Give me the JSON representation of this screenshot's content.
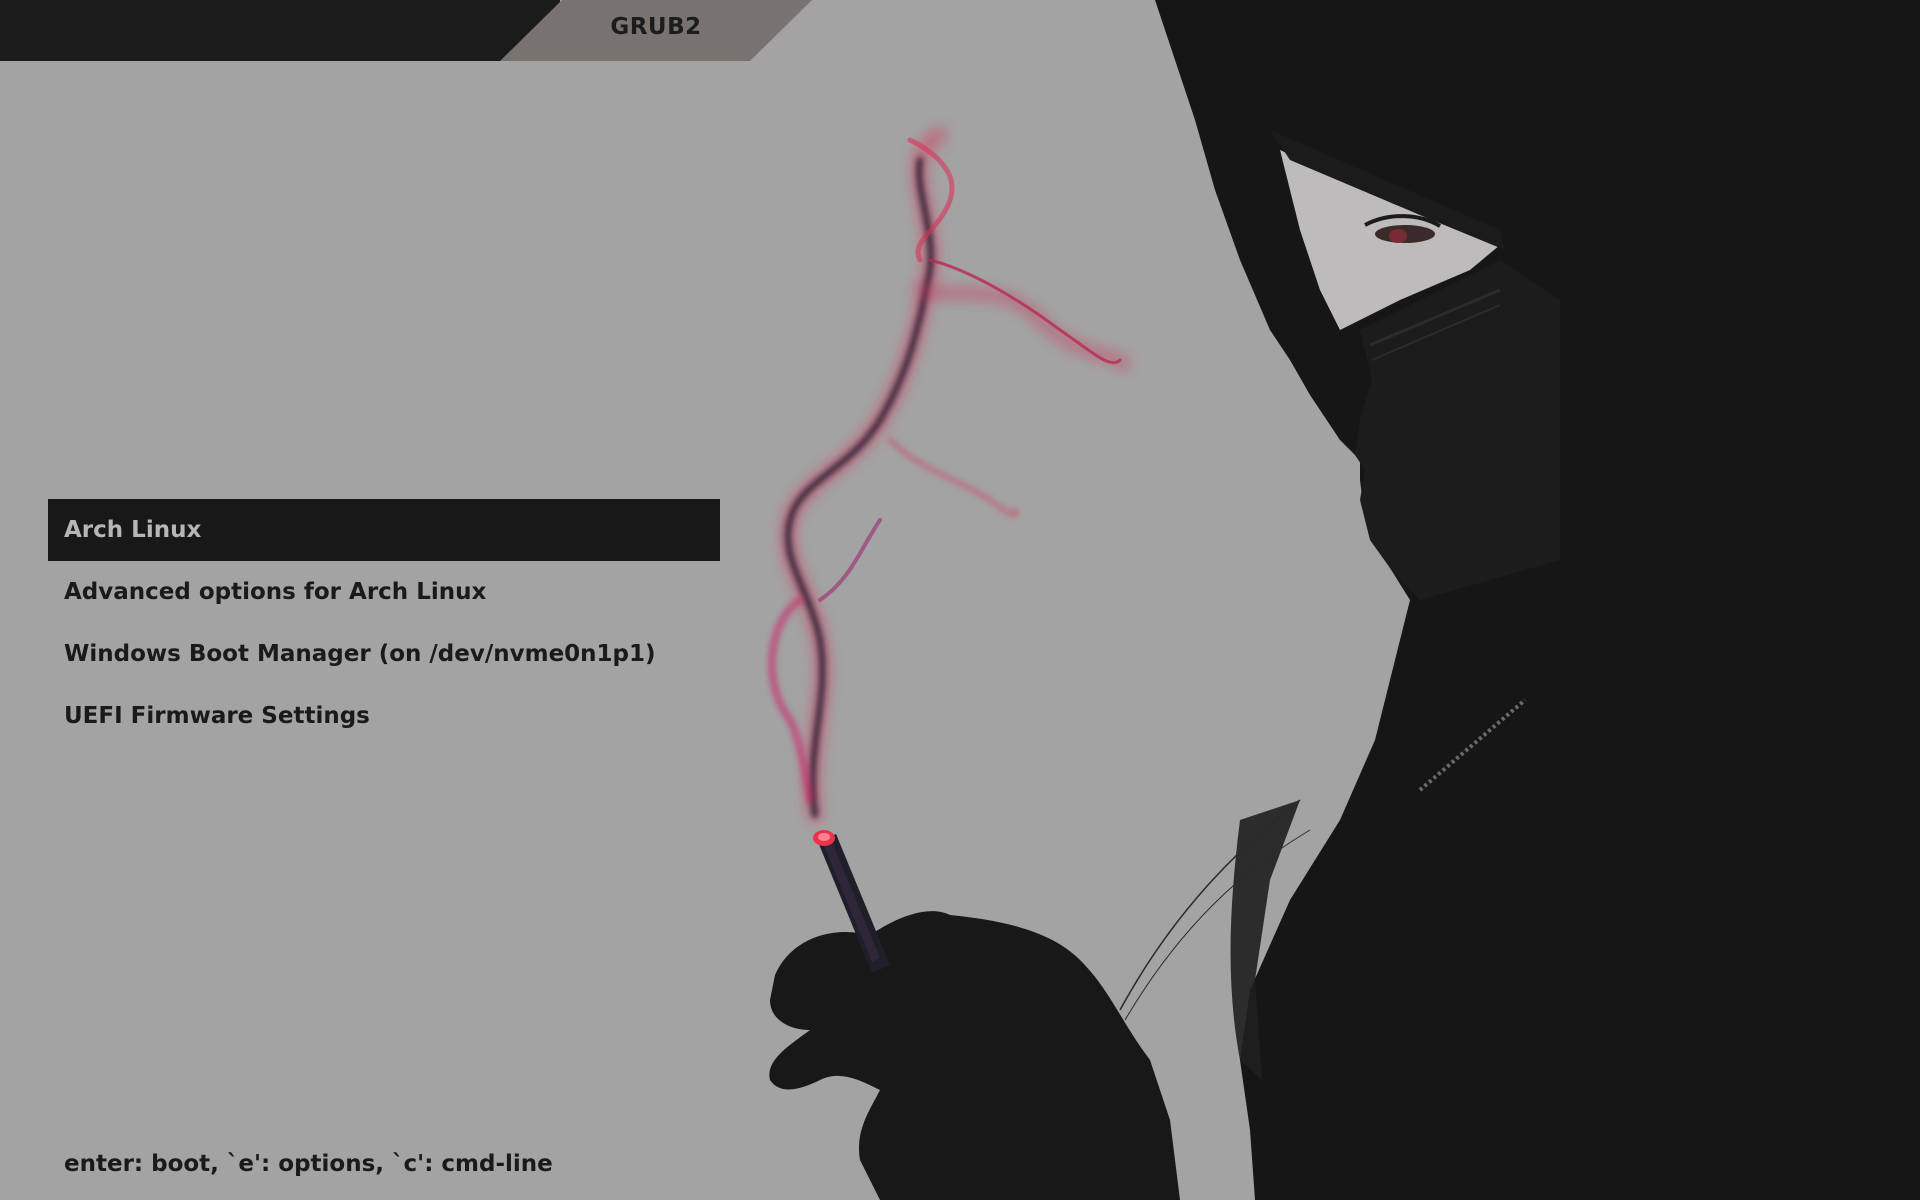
{
  "header": {
    "title": "GRUB2"
  },
  "menu": {
    "items": [
      {
        "label": "Arch Linux",
        "selected": true
      },
      {
        "label": "Advanced options for Arch Linux",
        "selected": false
      },
      {
        "label": "Windows Boot Manager (on /dev/nvme0n1p1)",
        "selected": false
      },
      {
        "label": "UEFI Firmware Settings",
        "selected": false
      }
    ]
  },
  "footer": {
    "help_text": "enter: boot, `e': options, `c': cmd-line"
  },
  "colors": {
    "background": "#a3a3a3",
    "topbar": "#1b1b1b",
    "tab": "#79736f",
    "selection_bg": "#181818",
    "selection_text": "#b6b6b6",
    "text": "#1a1a1a",
    "smoke": "#d8345a"
  }
}
